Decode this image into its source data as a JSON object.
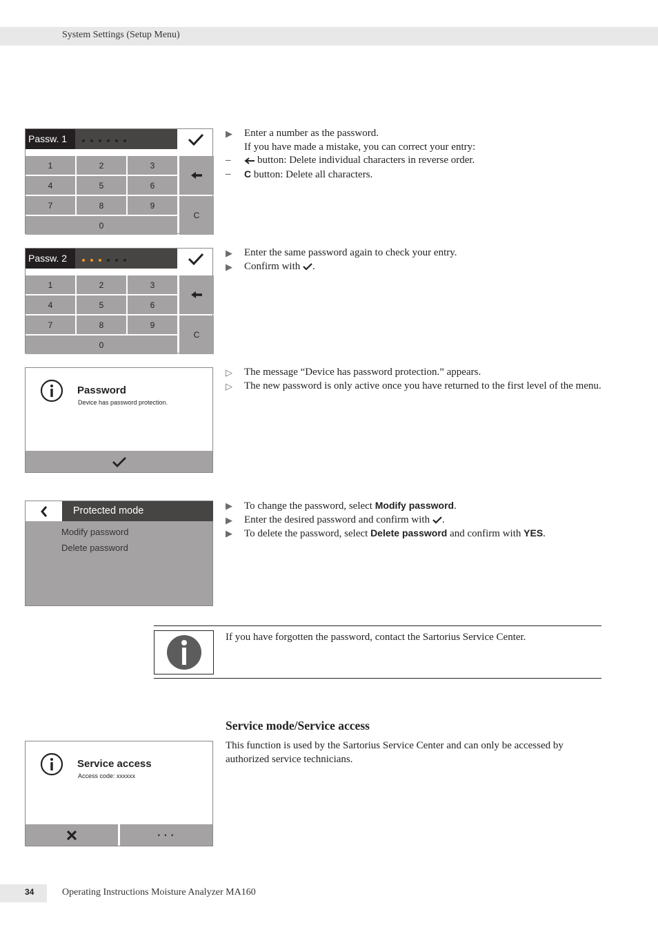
{
  "header": {
    "title": "System Settings (Setup Menu)"
  },
  "keypad1": {
    "label": "Passw. 1",
    "dots_total": 6,
    "dots_entered": 0,
    "keys": [
      "1",
      "2",
      "3",
      "4",
      "5",
      "6",
      "7",
      "8",
      "9",
      "0"
    ],
    "backspace_icon": "arrow-left-icon",
    "clear_label": "C",
    "confirm_icon": "check-icon"
  },
  "keypad2": {
    "label": "Passw. 2",
    "dots_total": 6,
    "dots_entered": 3,
    "keys": [
      "1",
      "2",
      "3",
      "4",
      "5",
      "6",
      "7",
      "8",
      "9",
      "0"
    ],
    "backspace_icon": "arrow-left-icon",
    "clear_label": "C",
    "confirm_icon": "check-icon",
    "accent_color": "#f39a22"
  },
  "instructions1": {
    "step": "Enter a number as the password.",
    "note": "If you have made a mistake, you can correct your entry:",
    "sub1_text": " button: Delete individual characters in reverse order.",
    "sub2_key": "C",
    "sub2_text": " button: Delete all characters."
  },
  "instructions2": {
    "step1": "Enter the same password again to check your entry.",
    "step2_prefix": "Confirm with ",
    "step2_suffix": "."
  },
  "password_dialog": {
    "title": "Password",
    "message": "Device has password protection."
  },
  "instructions3": {
    "result1": "The message “Device has password protection.” appears.",
    "result2": "The new password is only active once you have returned to the first level of the menu."
  },
  "protected_menu": {
    "title": "Protected mode",
    "items": [
      "Modify password",
      "Delete password"
    ]
  },
  "instructions4": {
    "s1_prefix": "To change the password, select ",
    "s1_bold": "Modify password",
    "s1_suffix": ".",
    "s2_prefix": "Enter the desired password and confirm with ",
    "s2_suffix": ".",
    "s3_prefix": "To delete the password, select ",
    "s3_bold": "Delete password",
    "s3_mid": " and confirm with ",
    "s3_bold2": "YES",
    "s3_suffix": "."
  },
  "note": {
    "text": "If you have forgotten the password, contact the Sartorius Service Center."
  },
  "service": {
    "heading": "Service mode/Service access",
    "body": "This function is used by the Sartorius Service Center and can only be accessed by authorized service technicians.",
    "dialog_title": "Service access",
    "dialog_message": "Access code: xxxxxx",
    "more_label": "• • •"
  },
  "footer": {
    "page": "34",
    "title": "Operating Instructions Moisture Analyzer MA160"
  }
}
